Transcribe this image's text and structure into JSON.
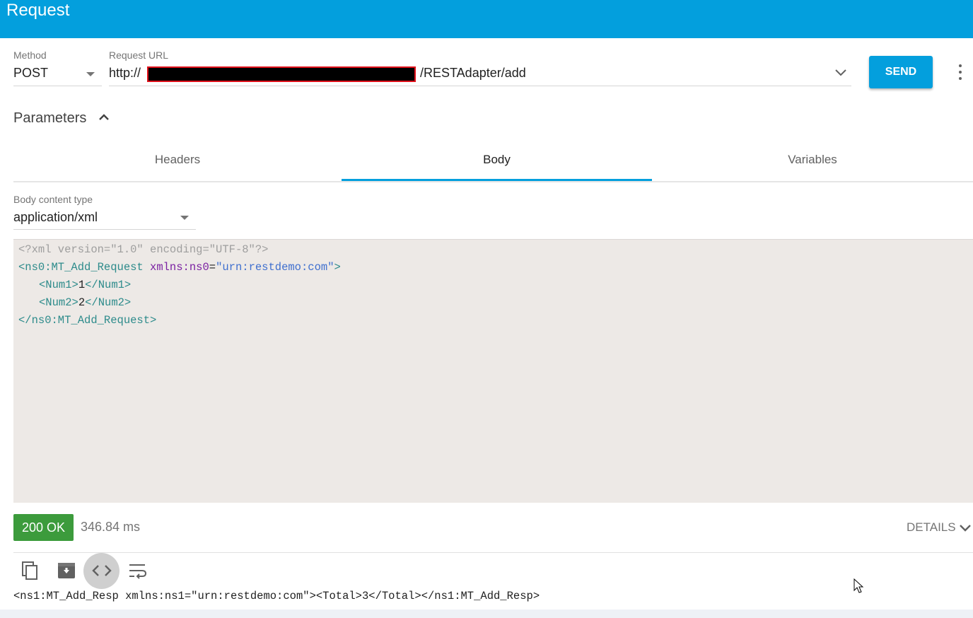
{
  "header": {
    "title": "Request"
  },
  "method": {
    "label": "Method",
    "value": "POST"
  },
  "url": {
    "label": "Request URL",
    "prefix": "http://",
    "suffix": "/RESTAdapter/add"
  },
  "actions": {
    "send_label": "SEND"
  },
  "parameters": {
    "title": "Parameters",
    "tabs": [
      {
        "label": "Headers",
        "active": false
      },
      {
        "label": "Body",
        "active": true
      },
      {
        "label": "Variables",
        "active": false
      }
    ]
  },
  "body": {
    "content_type_label": "Body content type",
    "content_type_value": "application/xml",
    "code": {
      "line1": "<?xml version=\"1.0\" encoding=\"UTF-8\"?>",
      "line2_tag_open": "<ns0:MT_Add_Request ",
      "line2_attr": "xmlns:ns0",
      "line2_eq": "=",
      "line2_val": "\"urn:restdemo:com\"",
      "line2_close": ">",
      "line3_open": "<Num1>",
      "line3_val": "1",
      "line3_close": "</Num1>",
      "line4_open": "<Num2>",
      "line4_val": "2",
      "line4_close": "</Num2>",
      "line5": "</ns0:MT_Add_Request>"
    }
  },
  "response": {
    "status": "200 OK",
    "time": "346.84 ms",
    "details_label": "DETAILS",
    "body": "<ns1:MT_Add_Resp xmlns:ns1=\"urn:restdemo:com\"><Total>3</Total></ns1:MT_Add_Resp>"
  },
  "colors": {
    "brand": "#039fdd",
    "status_ok": "#3c9b3c",
    "redaction_border": "#e0101a"
  },
  "icons": [
    "more-vert-icon",
    "chevron-up-icon",
    "chevron-down-icon",
    "copy-icon",
    "save-icon",
    "code-icon",
    "wrap-text-icon",
    "mouse-cursor-icon"
  ]
}
